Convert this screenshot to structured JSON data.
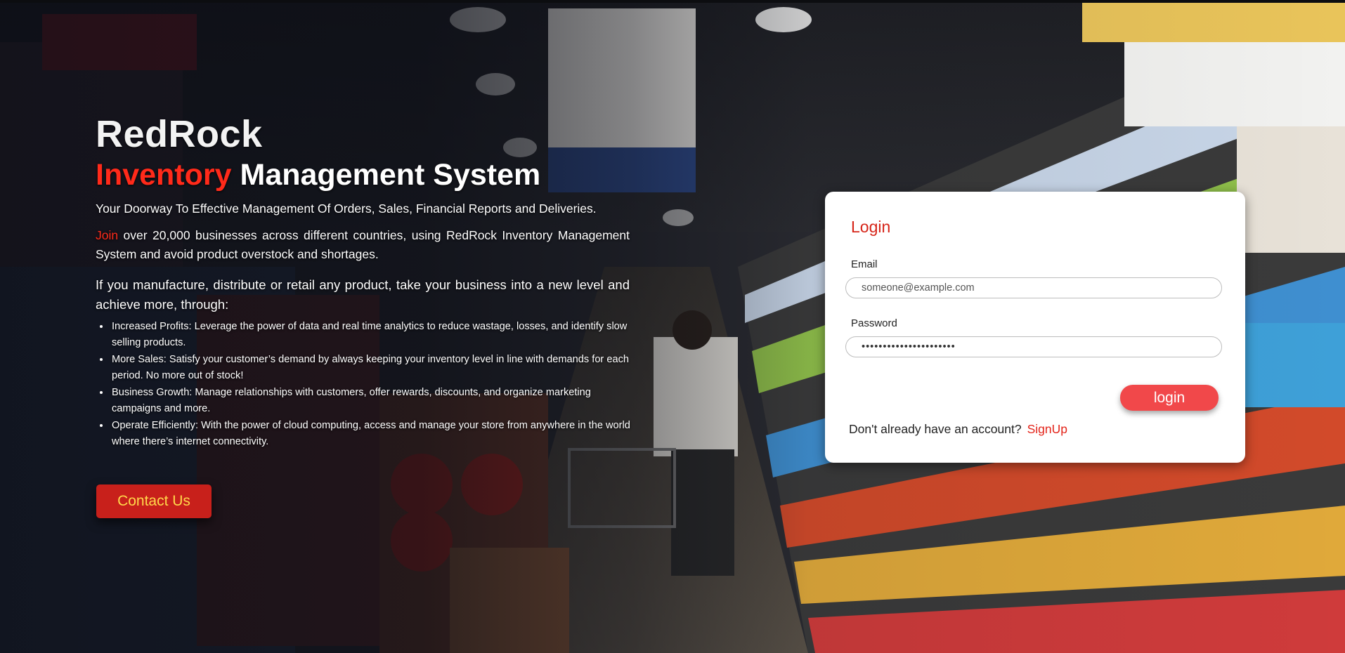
{
  "hero": {
    "brand": "RedRock",
    "headline_accent": "Inventory",
    "headline_rest": " Management System",
    "tagline": "Your Doorway To Effective Management Of Orders, Sales, Financial Reports and Deliveries.",
    "join_word": "Join",
    "join_text": " over 20,000 businesses across different countries, using RedRock Inventory Management System and avoid product overstock and shortages.",
    "intro": "If you manufacture, distribute or retail any product, take your business into a new level and achieve more, through:",
    "benefits": [
      "Increased Profits: Leverage the power of data and real time analytics to reduce wastage, losses, and identify slow selling products.",
      "More Sales: Satisfy your customer’s demand by always keeping your inventory level in line with demands for each period. No more out of stock!",
      "Business Growth: Manage relationships with customers, offer rewards, discounts, and organize marketing campaigns and more.",
      "Operate Efficiently: With the power of cloud computing, access and manage your store from anywhere in the world where there’s internet connectivity."
    ],
    "contact_label": "Contact Us"
  },
  "login": {
    "title": "Login",
    "email_label": "Email",
    "email_placeholder": "someone@example.com",
    "password_label": "Password",
    "password_value": "••••••••••••••••••••••",
    "submit_label": "login",
    "signup_prompt": "Don't already have an account?",
    "signup_link": "SignUp"
  },
  "colors": {
    "accent": "#ff2a1a",
    "contact_button": "#c8201b",
    "contact_text": "#ffd84a",
    "login_button": "#f1484a"
  }
}
